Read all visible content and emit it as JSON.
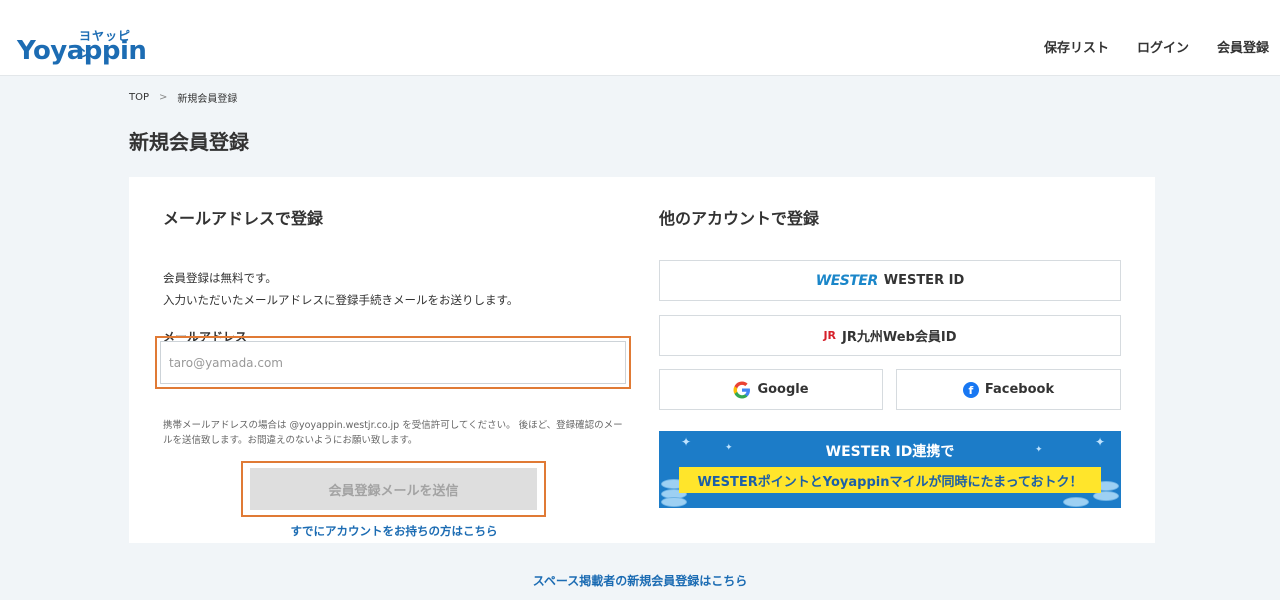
{
  "header": {
    "logo_kana": "ヨヤッピン",
    "logo_word": "Yoyappin",
    "nav": [
      "保存リスト",
      "ログイン",
      "会員登録"
    ]
  },
  "breadcrumb": {
    "top": "TOP",
    "current": "新規会員登録"
  },
  "page_title": "新規会員登録",
  "email_section": {
    "title": "メールアドレスで登録",
    "desc_line1": "会員登録は無料です。",
    "desc_line2": "入力いただいたメールアドレスに登録手続きメールをお送りします。",
    "field_label": "メールアドレス",
    "placeholder": "taro@yamada.com",
    "note": "携帯メールアドレスの場合は @yoyappin.westjr.co.jp を受信許可してください。 後ほど、登録確認のメールを送信致します。お間違えのないようにお願い致します。",
    "submit_label": "会員登録メールを送信",
    "login_link": "すでにアカウントをお持ちの方はこちら"
  },
  "other_section": {
    "title": "他のアカウントで登録",
    "wester_mark": "WESTER",
    "wester_label": "WESTER ID",
    "jr_mark": "JR",
    "jr_label": "JR九州Web会員ID",
    "google_label": "Google",
    "facebook_label": "Facebook",
    "banner_line1": "WESTER ID連携で",
    "banner_line2": "WESTERポイントとYoyappinマイルが同時にたまっておトク！"
  },
  "space_link": "スペース掲載者の新規会員登録はこちら",
  "colors": {
    "brand": "#1c6cb3",
    "highlight": "#e07a35",
    "banner": "#1c7cc8",
    "banner_strip": "#ffe52b"
  }
}
